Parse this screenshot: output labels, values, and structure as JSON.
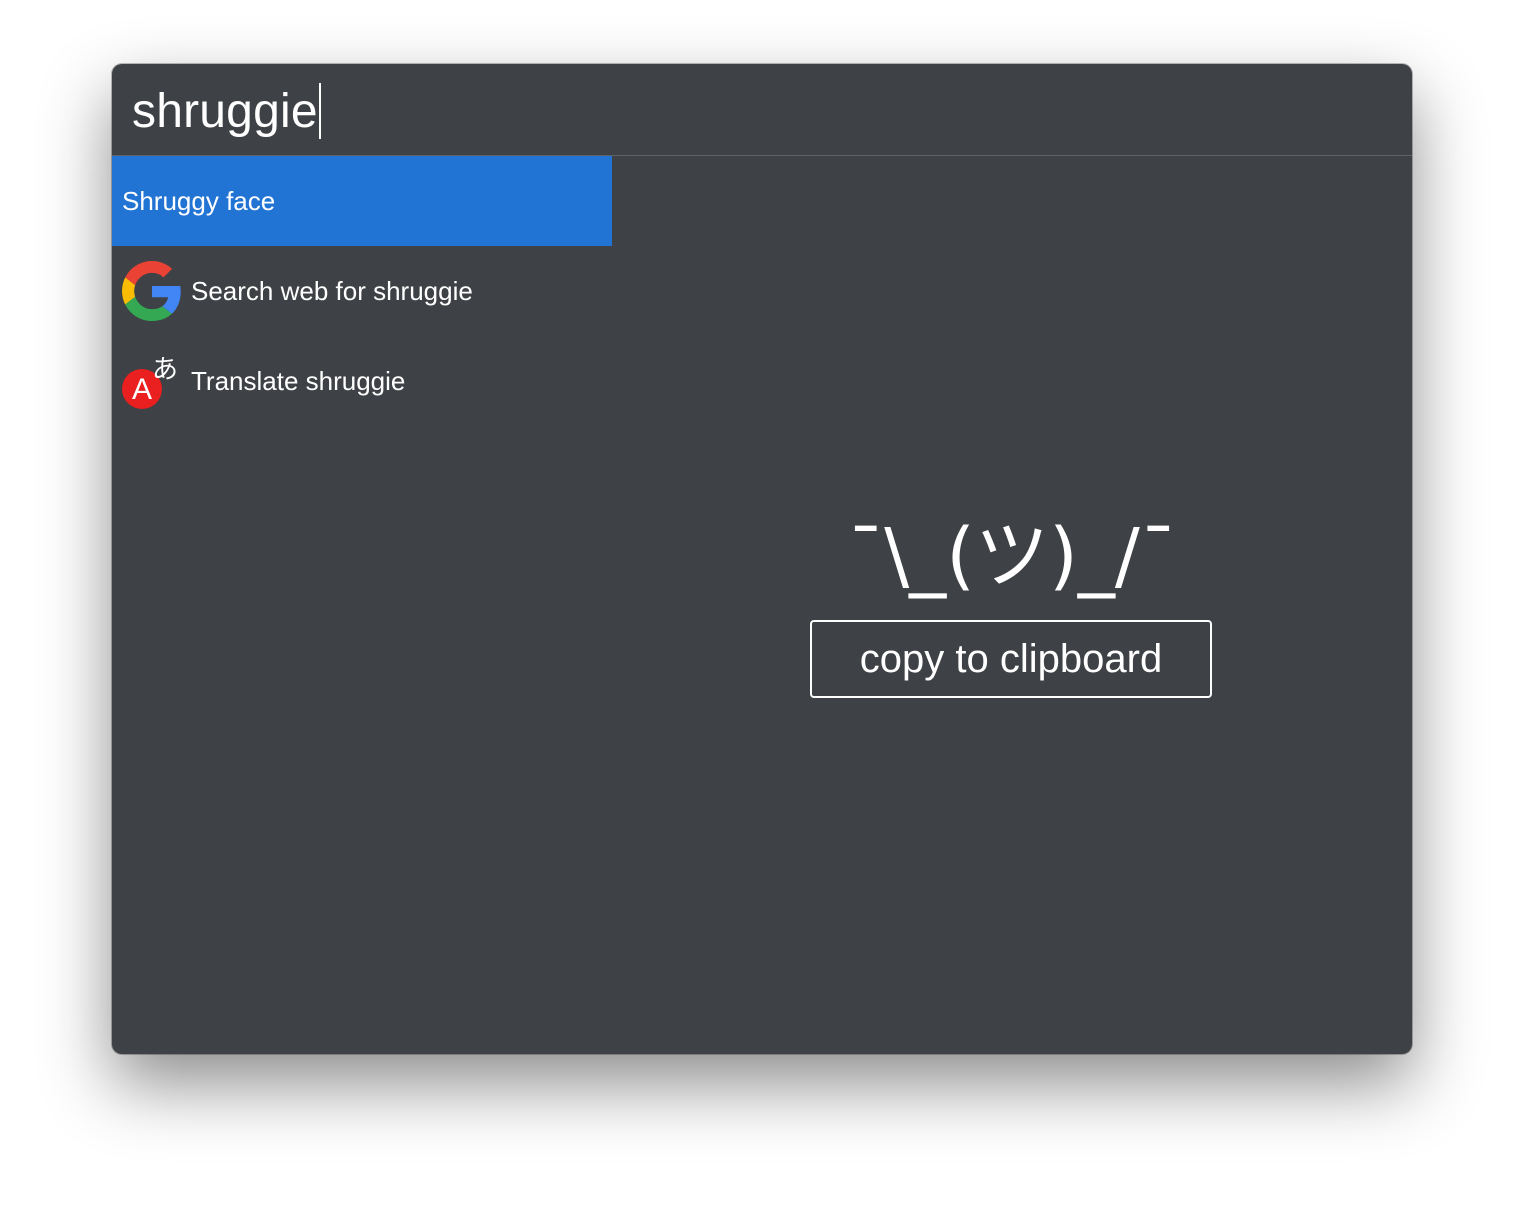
{
  "search": {
    "value": "shruggie"
  },
  "results": [
    {
      "label": "Shruggy face",
      "selected": true,
      "icon": "none"
    },
    {
      "label": "Search web for shruggie",
      "selected": false,
      "icon": "google-icon"
    },
    {
      "label": "Translate shruggie",
      "selected": false,
      "icon": "translate-icon"
    }
  ],
  "icons": {
    "translate_letter": "A",
    "translate_kana": "あ"
  },
  "preview": {
    "shrug": "¯\\_(ツ)_/¯",
    "copy_label": "copy to clipboard"
  },
  "colors": {
    "window_bg": "#3e4145",
    "selected_bg": "#2274d4",
    "translate_red": "#ea1f1f",
    "google_blue": "#4285F4",
    "google_red": "#EA4335",
    "google_yellow": "#FBBC05",
    "google_green": "#34A853"
  }
}
